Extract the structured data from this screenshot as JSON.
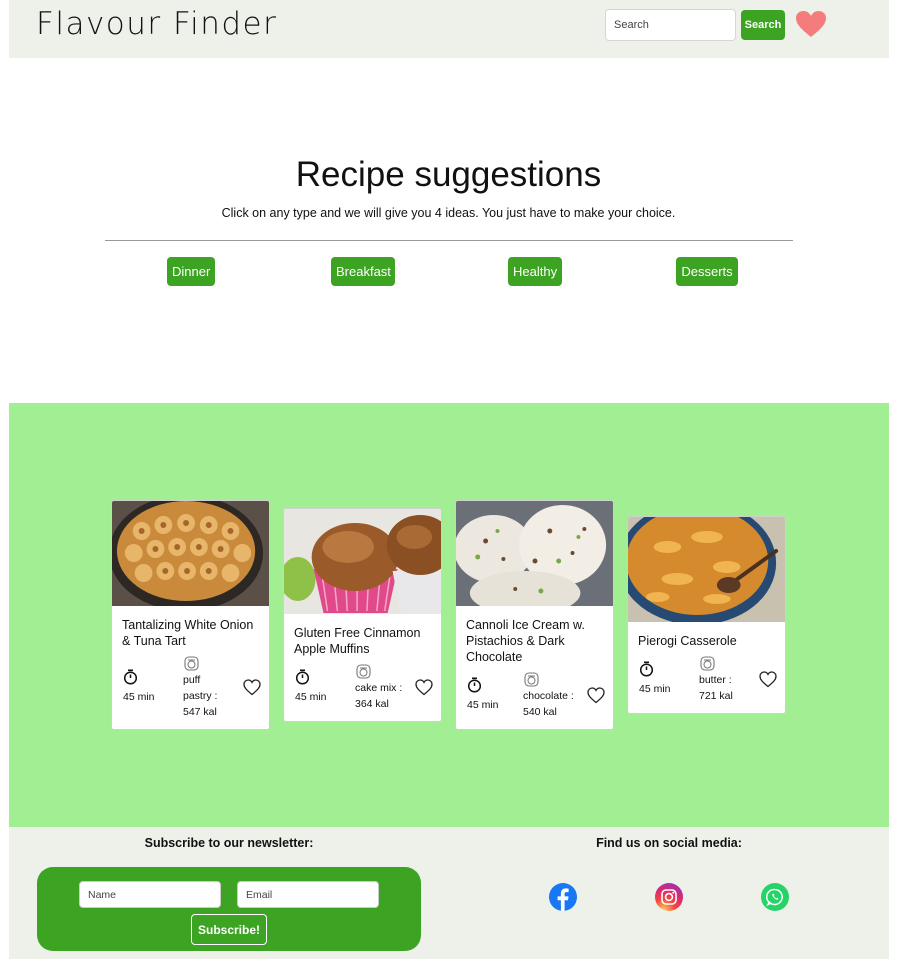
{
  "header": {
    "logo": "Flavour Finder",
    "search_placeholder": "Search",
    "search_button": "Search",
    "favorites_icon": "heart-icon",
    "accent": "#3da322",
    "heart_color": "#f47c7c"
  },
  "suggestions": {
    "title": "Recipe suggestions",
    "subtitle": "Click on any type and we will give you 4 ideas. You just have to make your choice.",
    "categories": [
      "Dinner",
      "Breakfast",
      "Healthy",
      "Desserts"
    ]
  },
  "recipes": [
    {
      "title": "Tantalizing White Onion & Tuna Tart",
      "time": "45 min",
      "ingredient": "puff pastry : 547 kal"
    },
    {
      "title": "Gluten Free Cinnamon Apple Muffins",
      "time": "45 min",
      "ingredient": "cake mix : 364 kal"
    },
    {
      "title": "Cannoli Ice Cream w. Pistachios & Dark Chocolate",
      "time": "45 min",
      "ingredient": "chocolate : 540 kal"
    },
    {
      "title": "Pierogi Casserole",
      "time": "45 min",
      "ingredient": "butter : 721 kal"
    }
  ],
  "footer": {
    "newsletter_label": "Subscribe to our newsletter:",
    "name_placeholder": "Name",
    "email_placeholder": "Email",
    "subscribe_button": "Subscribe!",
    "social_label": "Find us on social media:",
    "social_icons": [
      "facebook-icon",
      "instagram-icon",
      "whatsapp-icon"
    ]
  },
  "colors": {
    "header_bg": "#edf1ea",
    "band_bg": "#a2ee92",
    "button_green": "#3da322"
  }
}
